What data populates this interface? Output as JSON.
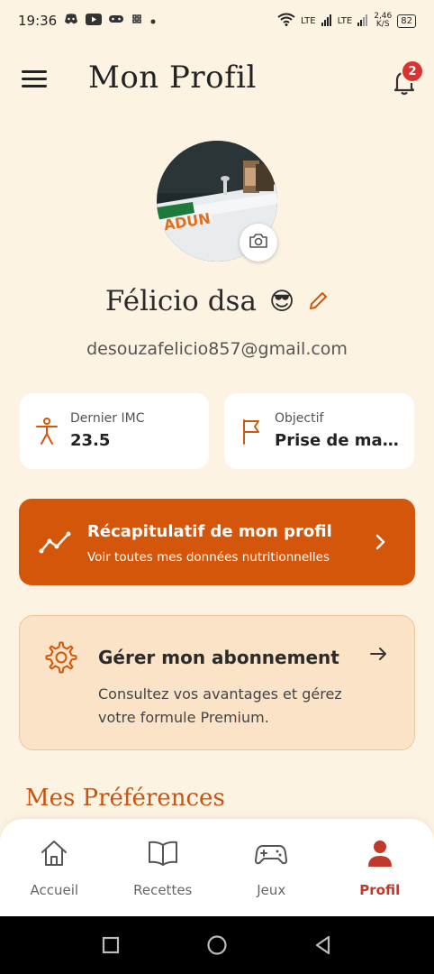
{
  "status_bar": {
    "time": "19:36",
    "network1": "LTE",
    "network2": "LTE",
    "speed_value": "2,46",
    "speed_unit": "K/S",
    "battery": "82"
  },
  "header": {
    "title": "Mon Profil",
    "notification_count": "2"
  },
  "profile": {
    "name": "Félicio dsa",
    "emoji": "😎",
    "email": "desouzafelicio857@gmail.com",
    "photo_text": "ADUN"
  },
  "stats": {
    "imc_label": "Dernier IMC",
    "imc_value": "23.5",
    "goal_label": "Objectif",
    "goal_value": "Prise de masse"
  },
  "summary": {
    "title": "Récapitulatif de mon profil",
    "subtitle": "Voir toutes mes données nutritionnelles"
  },
  "subscription": {
    "title": "Gérer mon abonnement",
    "description": "Consultez vos avantages et gérez votre formule Premium."
  },
  "preferences": {
    "title": "Mes Préférences"
  },
  "bottom_nav": {
    "items": [
      {
        "label": "Accueil",
        "icon": "home-icon"
      },
      {
        "label": "Recettes",
        "icon": "book-icon"
      },
      {
        "label": "Jeux",
        "icon": "gamepad-icon"
      },
      {
        "label": "Profil",
        "icon": "user-icon"
      }
    ],
    "active": "Profil"
  },
  "colors": {
    "background": "#fdf3e2",
    "accent": "#d4560a",
    "badge": "#d93232",
    "active_nav": "#c0392b",
    "subscription_bg": "#fbe3c8"
  }
}
